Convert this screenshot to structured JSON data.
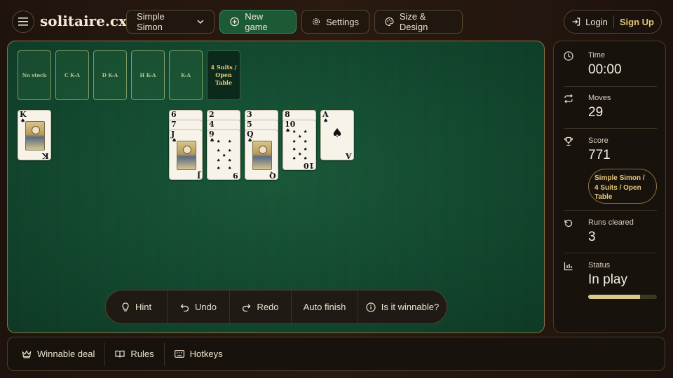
{
  "header": {
    "logo": "solitaire.cx",
    "game_variant": "Simple Simon",
    "new_game": "New game",
    "settings": "Settings",
    "size_design": "Size & Design",
    "login": "Login",
    "signup": "Sign Up"
  },
  "foundations": [
    {
      "label": "No stock"
    },
    {
      "label": "C K-A"
    },
    {
      "label": "D K-A"
    },
    {
      "label": "H K-A"
    },
    {
      "label": "K-A"
    }
  ],
  "mode_slot": {
    "label": "4 Suits / Open Table"
  },
  "tableau": [
    {
      "cards": [
        {
          "rank": "K",
          "suit": "♠",
          "face": true
        }
      ]
    },
    {
      "cards": [
        {
          "rank": "6",
          "suit": "♠"
        },
        {
          "rank": "7",
          "suit": "♠"
        },
        {
          "rank": "J",
          "suit": "♠",
          "face": true
        }
      ]
    },
    {
      "cards": [
        {
          "rank": "2",
          "suit": "♠"
        },
        {
          "rank": "4",
          "suit": "♠"
        },
        {
          "rank": "9",
          "suit": "♠"
        }
      ]
    },
    {
      "cards": [
        {
          "rank": "3",
          "suit": "♠"
        },
        {
          "rank": "5",
          "suit": "♠"
        },
        {
          "rank": "Q",
          "suit": "♠",
          "face": true
        }
      ]
    },
    {
      "cards": [
        {
          "rank": "8",
          "suit": "♠"
        },
        {
          "rank": "10",
          "suit": "♠"
        }
      ]
    },
    {
      "cards": [
        {
          "rank": "A",
          "suit": "♠"
        }
      ]
    }
  ],
  "actions": {
    "hint": "Hint",
    "undo": "Undo",
    "redo": "Redo",
    "auto_finish": "Auto finish",
    "winnable": "Is it winnable?"
  },
  "stats": {
    "time_label": "Time",
    "time_value": "00:00",
    "moves_label": "Moves",
    "moves_value": "29",
    "score_label": "Score",
    "score_value": "771",
    "mode_chip": "Simple Simon / 4 Suits / Open Table",
    "runs_label": "Runs cleared",
    "runs_value": "3",
    "status_label": "Status",
    "status_value": "In play",
    "progress": 0.75
  },
  "footer": {
    "winnable_deal": "Winnable deal",
    "rules": "Rules",
    "hotkeys": "Hotkeys"
  },
  "colors": {
    "felt": "#134a30",
    "accent_gold": "#e8c87a",
    "primary_green": "#1c5a36"
  }
}
